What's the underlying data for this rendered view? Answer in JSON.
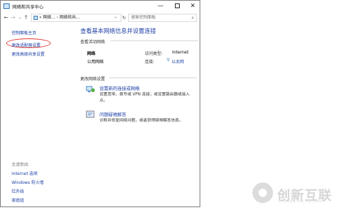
{
  "window": {
    "title": "网络和共享中心",
    "minimize": "—",
    "close": "✕"
  },
  "address": {
    "back": "←",
    "forward": "→",
    "history": "⌄",
    "up": "↑",
    "crumb_prefix": "«",
    "crumb_1": "网络...",
    "crumb_sep": "›",
    "crumb_2": "网络和共...",
    "dropdown": "⌄",
    "refresh": "↻",
    "search_placeholder": "搜索控制面板",
    "search_icon": "search-icon"
  },
  "sidebar": {
    "links": [
      "控制面板主页",
      "更改适配器设置",
      "更改高级共享设置"
    ],
    "see_also_label": "另请参阅",
    "see_also": [
      "Internet 选项",
      "Windows 防火墙",
      "红外线",
      "家庭组"
    ]
  },
  "main": {
    "title": "查看基本网络信息并设置连接",
    "active_networks_header": "查看活动网络",
    "network_name": "网络",
    "network_type": "公用网络",
    "access_type_label": "访问类型:",
    "access_type_value": "Internet",
    "connections_label": "连接:",
    "connections_value": "以太网",
    "change_settings_header": "更改网络设置",
    "tasks": [
      {
        "link": "设置新的连接或网络",
        "desc": "设置宽带、拨号或 VPN 连接；或设置路由器或接入点。",
        "icon": "network-setup-icon"
      },
      {
        "link": "问题疑难解答",
        "desc": "诊断并修复网络问题，或者获得疑难解答信息。",
        "icon": "troubleshoot-icon"
      }
    ]
  },
  "watermark": {
    "text": "创新互联",
    "sub": "CHUANG XIN HU LIAN"
  },
  "colors": {
    "link": "#1a3ea6",
    "title_blue": "#1e3fa7",
    "highlight_circle": "#e53530"
  }
}
